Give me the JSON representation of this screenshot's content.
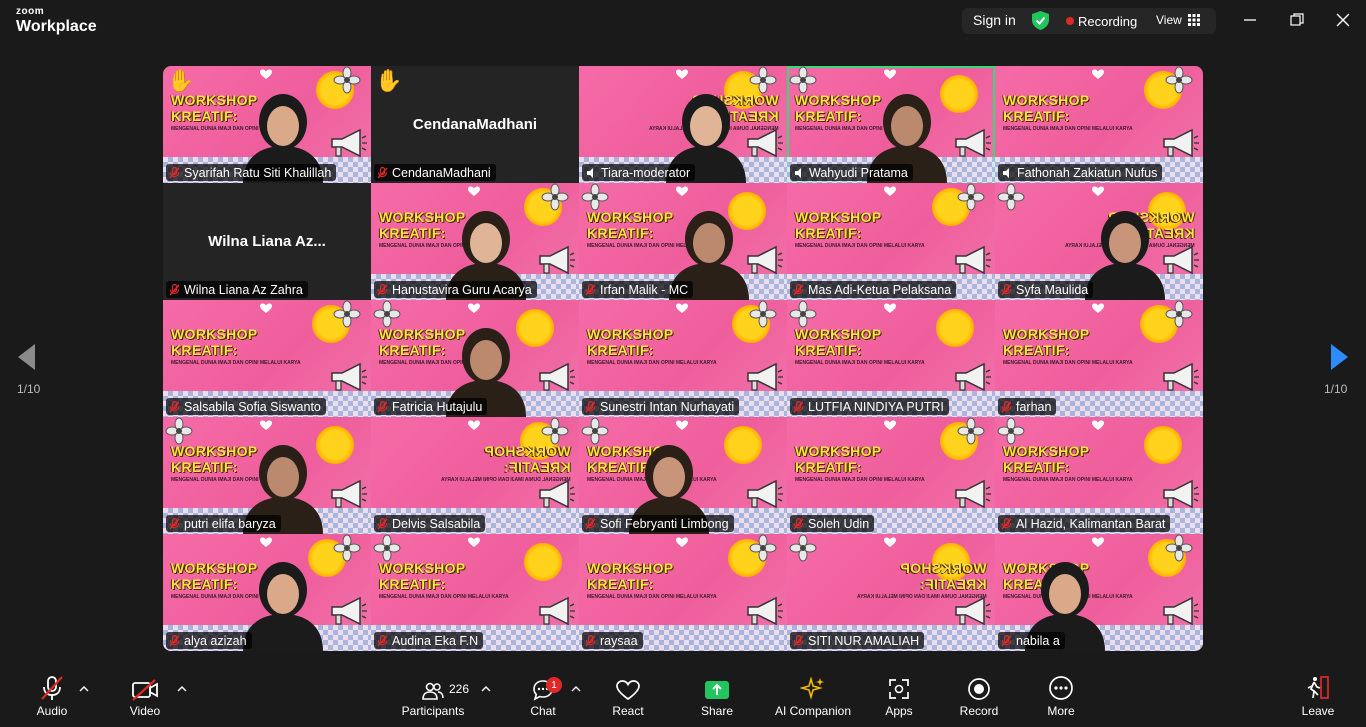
{
  "app": {
    "brand_small": "zoom",
    "brand_large": "Workplace"
  },
  "topbar": {
    "sign_in": "Sign in",
    "recording": "Recording",
    "view": "View",
    "shield_color": "#22c55e",
    "recording_color": "#e02828"
  },
  "pagination": {
    "left": "1/10",
    "right": "1/10"
  },
  "accent_active": "#39d87a",
  "tiles": [
    {
      "name": "Syarifah Ratu Siti Khalillah",
      "bg": "pink",
      "hand": true
    },
    {
      "name": "CendanaMadhani",
      "bg": "dark",
      "hand": true,
      "display": "CendanaMadhani"
    },
    {
      "name": "Tiara-moderator",
      "bg": "pink",
      "speaker": true
    },
    {
      "name": "Wahyudi Pratama",
      "bg": "pink",
      "speaker": true,
      "active": true
    },
    {
      "name": "Fathonah Zakiatun Nufus",
      "bg": "pink",
      "speaker": true
    },
    {
      "name": "Wilna Liana Az Zahra",
      "bg": "dark",
      "display": "Wilna Liana Az..."
    },
    {
      "name": "Hanustavira Guru Acarya",
      "bg": "pink"
    },
    {
      "name": "Irfan Malik - MC",
      "bg": "pink"
    },
    {
      "name": "Mas Adi-Ketua Pelaksana",
      "bg": "pink"
    },
    {
      "name": "Syfa Maulida",
      "bg": "pink"
    },
    {
      "name": "Salsabila Sofia Siswanto",
      "bg": "pink"
    },
    {
      "name": "Fatricia Hutajulu",
      "bg": "pink"
    },
    {
      "name": "Sunestri Intan Nurhayati",
      "bg": "pink"
    },
    {
      "name": "LUTFIA NINDIYA PUTRI",
      "bg": "pink"
    },
    {
      "name": "farhan",
      "bg": "pink"
    },
    {
      "name": "putri elifa baryza",
      "bg": "pink"
    },
    {
      "name": "Delvis Salsabila",
      "bg": "pink"
    },
    {
      "name": "Sofi Febryanti Limbong",
      "bg": "pink"
    },
    {
      "name": "Soleh Udin",
      "bg": "pink"
    },
    {
      "name": "Al Hazid, Kalimantan Barat",
      "bg": "pink"
    },
    {
      "name": "alya azizah",
      "bg": "pink"
    },
    {
      "name": "Audina Eka F.N",
      "bg": "pink"
    },
    {
      "name": "raysaa",
      "bg": "pink"
    },
    {
      "name": "SITI NUR AMALIAH",
      "bg": "pink"
    },
    {
      "name": "nabila a",
      "bg": "pink"
    }
  ],
  "banner": {
    "line1": "WORKSHOP",
    "line2": "KREATIF:",
    "sub": "MENGENAL DUNIA IMAJI DAN OPINI MELALUI KARYA"
  },
  "toolbar": {
    "audio": "Audio",
    "video": "Video",
    "participants": "Participants",
    "participants_count": "226",
    "chat": "Chat",
    "chat_badge": "1",
    "react": "React",
    "share": "Share",
    "ai_companion": "AI Companion",
    "apps": "Apps",
    "record": "Record",
    "more": "More",
    "leave": "Leave",
    "share_color": "#22c55e",
    "ai_color": "#f5b800",
    "leave_color": "#e02828"
  }
}
